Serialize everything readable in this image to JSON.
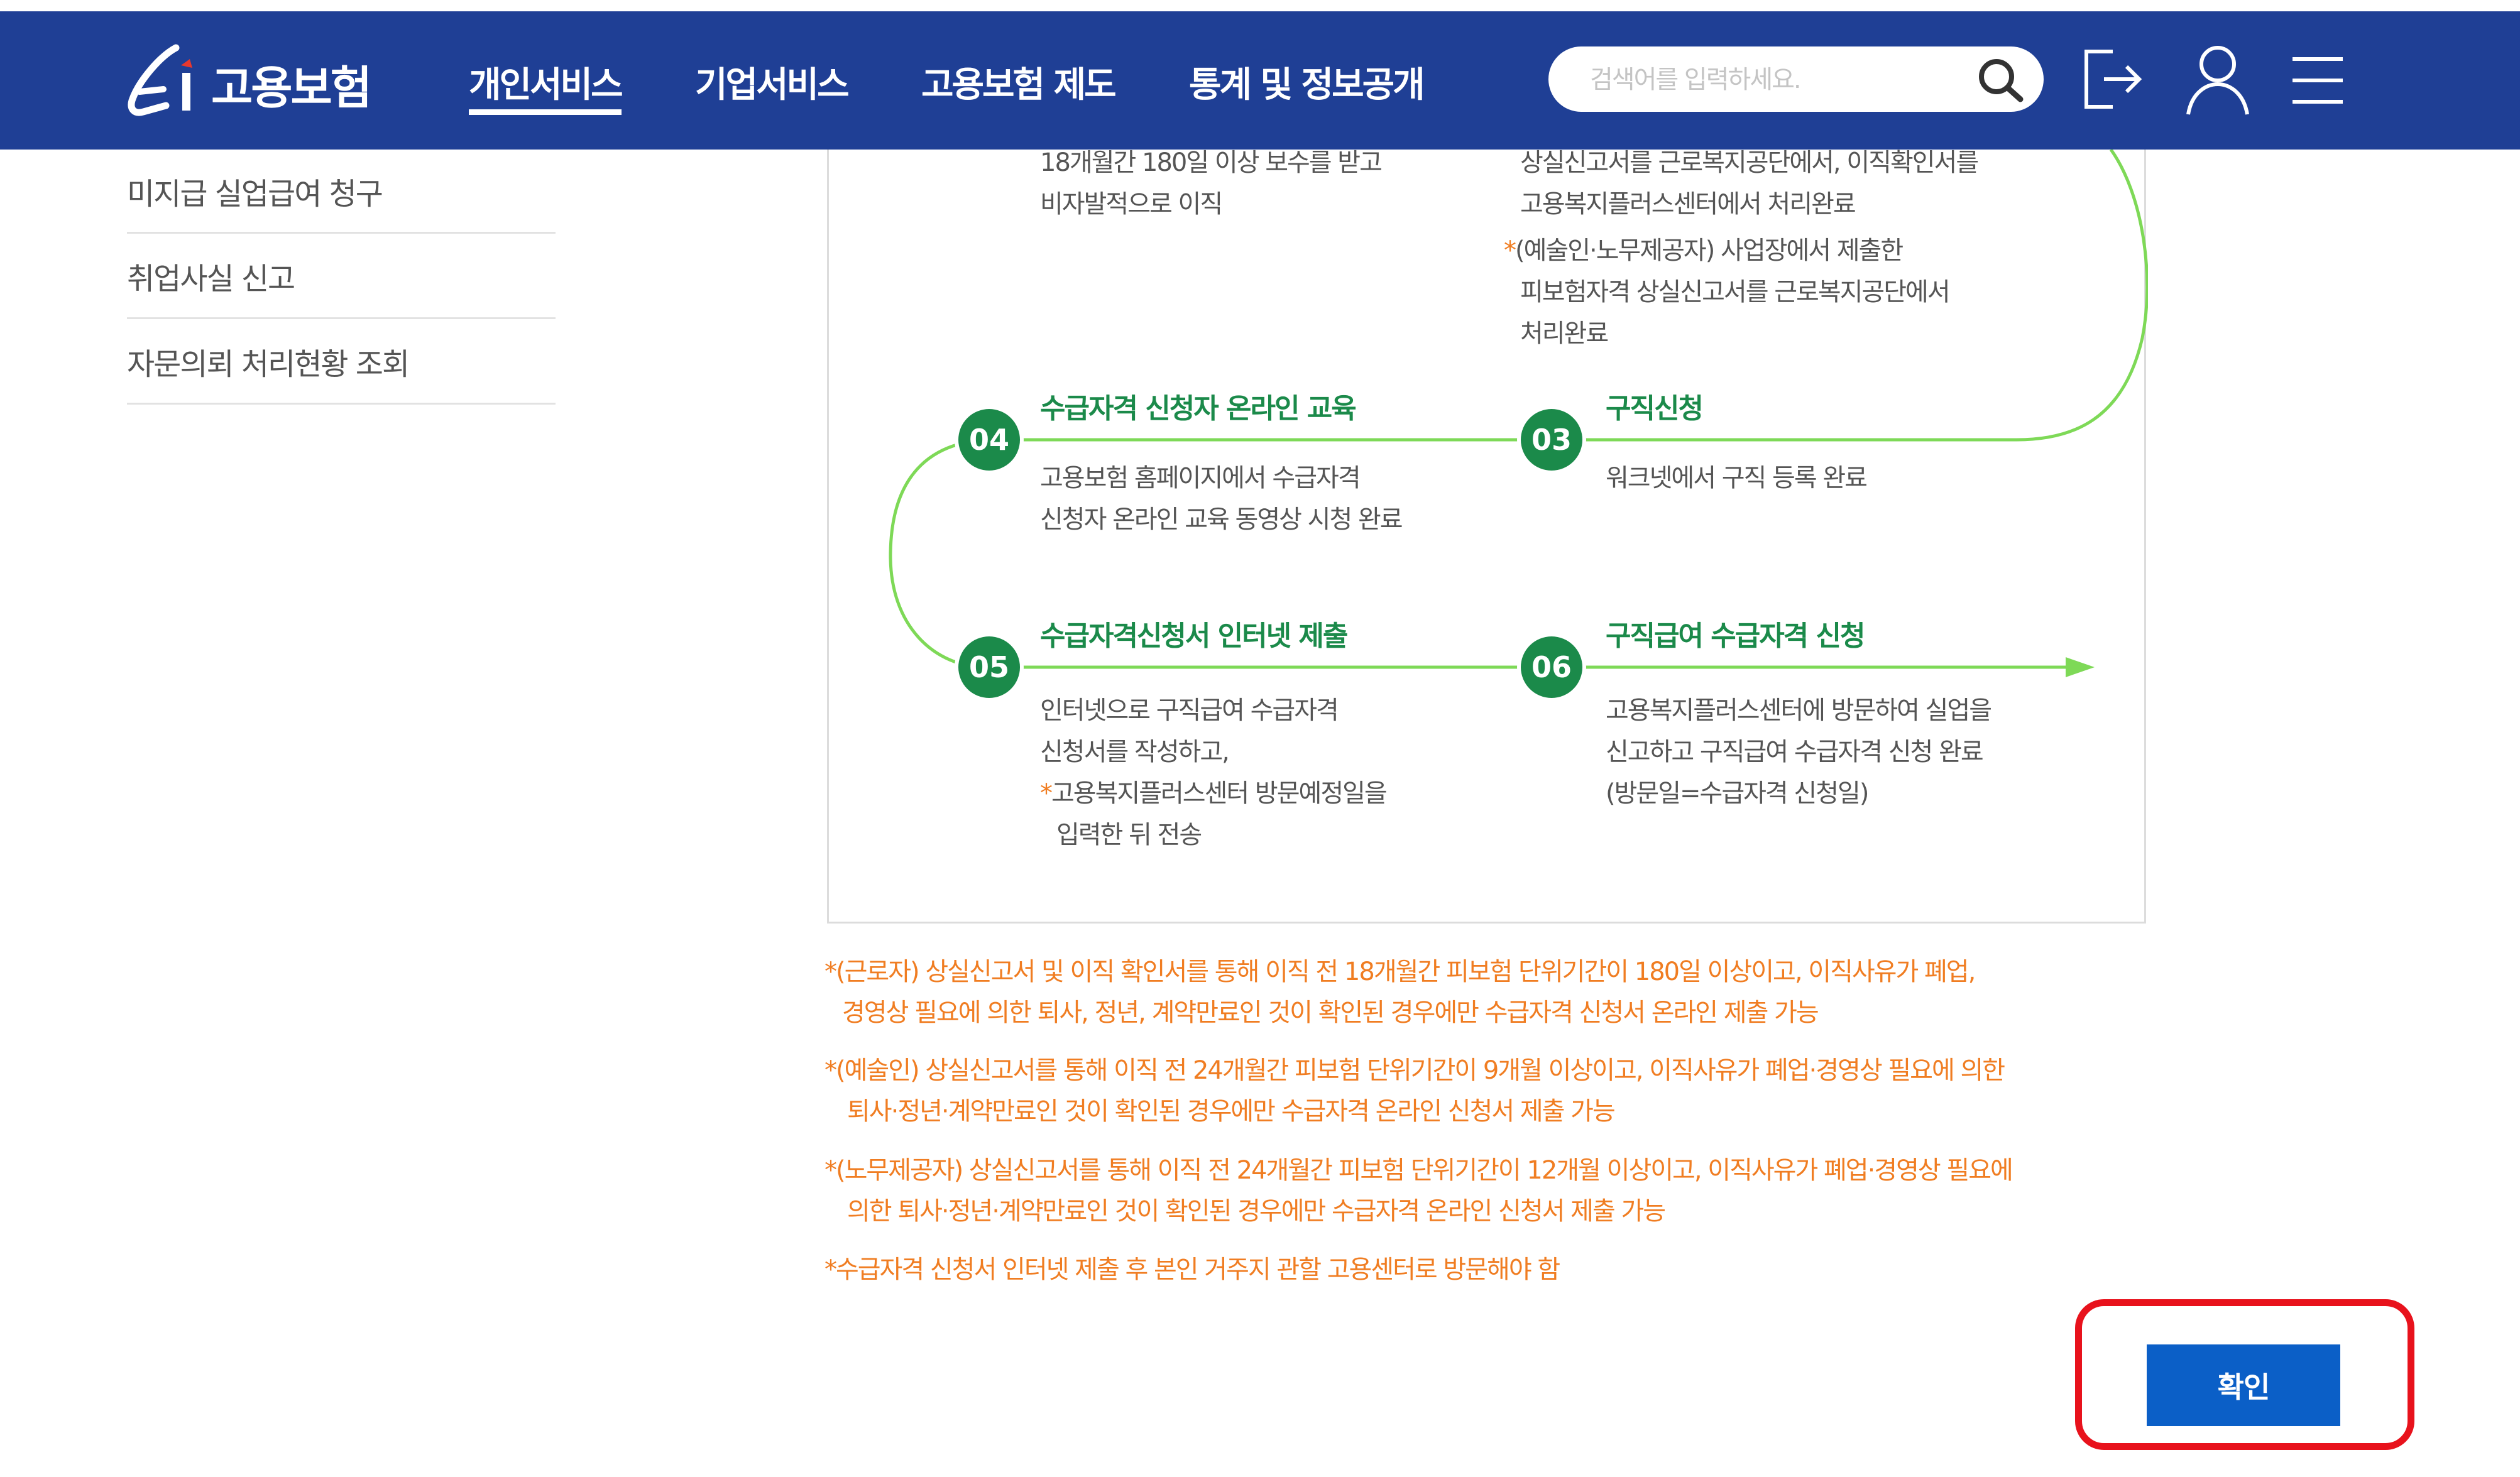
{
  "header": {
    "logo_text": "고용보험",
    "nav": [
      "개인서비스",
      "기업서비스",
      "고용보험 제도",
      "통계 및 정보공개"
    ],
    "active_nav": "개인서비스",
    "search_placeholder": "검색어를 입력하세요.",
    "icons": [
      "search-icon",
      "logout-icon",
      "user-icon",
      "menu-icon"
    ],
    "bar_color": "#1f3f95"
  },
  "sidebar": {
    "items": [
      {
        "label": "미지급 실업급여 청구"
      },
      {
        "label": "취업사실 신고"
      },
      {
        "label": "자문의뢰 처리현황 조회"
      }
    ]
  },
  "process": {
    "top_left": {
      "line1": "18개월간 180일 이상 보수를 받고",
      "line2": "비자발적으로 이직"
    },
    "top_right": {
      "line1": "상실신고서를 근로복지공단에서, 이직확인서를",
      "line2": "고용복지플러스센터에서 처리완료",
      "star": "*",
      "line3": "(예술인·노무제공자) 사업장에서 제출한",
      "line4": "피보험자격 상실신고서를 근로복지공단에서",
      "line5": "처리완료"
    },
    "steps": [
      {
        "num": "03",
        "title": "구직신청",
        "lines": [
          "워크넷에서 구직 등록 완료"
        ]
      },
      {
        "num": "04",
        "title": "수급자격 신청자 온라인 교육",
        "lines": [
          "고용보험 홈페이지에서 수급자격",
          "신청자 온라인 교육 동영상 시청 완료"
        ]
      },
      {
        "num": "05",
        "title": "수급자격신청서 인터넷 제출",
        "lines": [
          "인터넷으로 구직급여 수급자격",
          "신청서를 작성하고,"
        ],
        "star": "*",
        "star_lines": [
          "고용복지플러스센터 방문예정일을",
          "입력한 뒤 전송"
        ]
      },
      {
        "num": "06",
        "title": "구직급여 수급자격 신청",
        "lines": [
          "고용복지플러스센터에 방문하여 실업을",
          "신고하고 구직급여 수급자격 신청 완료",
          "(방문일=수급자격 신청일)"
        ]
      }
    ],
    "accent_color": "#1b8a4a",
    "line_color": "#7ed957"
  },
  "notes": [
    {
      "star": "*",
      "l1": "(근로자) 상실신고서 및 이직 확인서를 통해 이직 전 18개월간 피보험 단위기간이 180일 이상이고, 이직사유가 폐업,",
      "l2": "경영상 필요에 의한 퇴사, 정년, 계약만료인 것이 확인된 경우에만 수급자격 신청서 온라인 제출 가능"
    },
    {
      "star": "*",
      "l1": "(예술인) 상실신고서를 통해 이직 전 24개월간 피보험 단위기간이 9개월 이상이고, 이직사유가 폐업·경영상 필요에 의한",
      "l2": "퇴사·정년·계약만료인 것이 확인된 경우에만 수급자격 온라인 신청서 제출 가능"
    },
    {
      "star": "*",
      "l1": "(노무제공자) 상실신고서를 통해 이직 전 24개월간 피보험 단위기간이 12개월 이상이고, 이직사유가 폐업·경영상 필요에",
      "l2": "의한 퇴사·정년·계약만료인 것이 확인된 경우에만 수급자격 온라인 신청서 제출 가능"
    },
    {
      "star": "*",
      "l1": "수급자격 신청서 인터넷 제출 후 본인 거주지 관할 고용센터로 방문해야 함",
      "l2": ""
    }
  ],
  "note_color": "#f07d22",
  "confirm": {
    "label": "확인",
    "color": "#0b5fc7",
    "highlight_color": "#e8121c"
  }
}
